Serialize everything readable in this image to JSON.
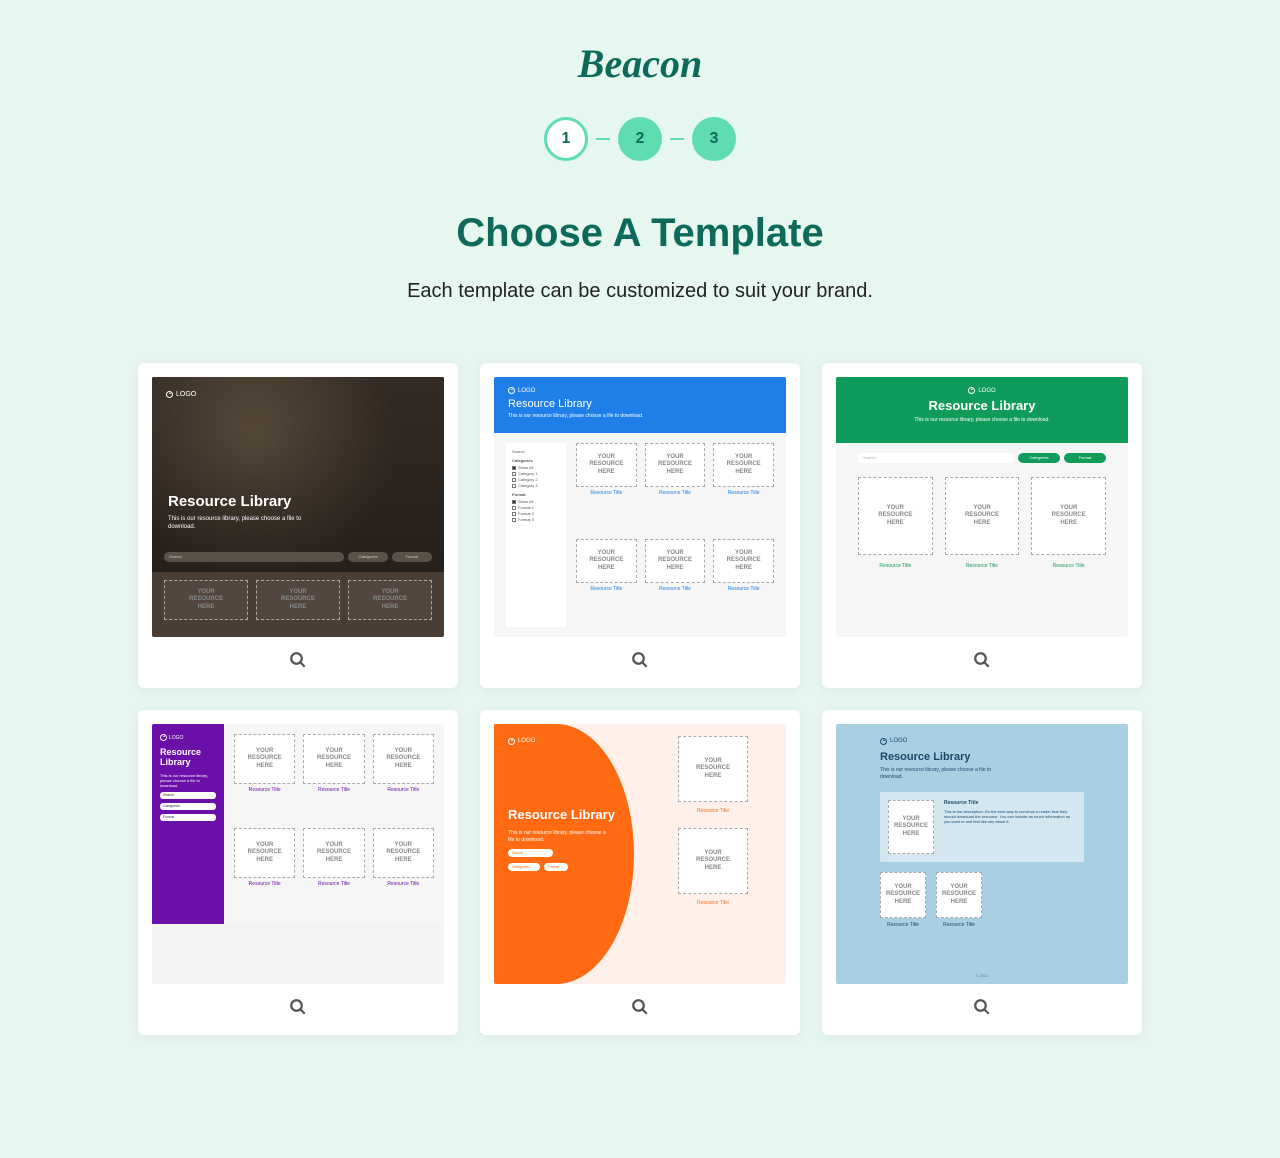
{
  "brand": "Beacon",
  "stepper": {
    "s1": "1",
    "s2": "2",
    "s3": "3"
  },
  "heading": "Choose A Template",
  "subtitle": "Each template can be customized to suit your brand.",
  "common": {
    "logo": "LOGO",
    "title": "Resource Library",
    "desc": "This is our resource library, please choose a file to download.",
    "search": "Search",
    "categories": "Categories",
    "format": "Format",
    "placeholder": "YOUR\nRESOURCE\nHERE",
    "res_title": "Resource Title"
  },
  "t2side": {
    "h_cat": "Categories",
    "show_all": "Show All",
    "cat1": "Category 1",
    "cat2": "Category 2",
    "cat3": "Category 3",
    "h_fmt": "Format",
    "fmt1": "Format 1",
    "fmt2": "Format 2",
    "fmt3": "Format 3"
  },
  "t4desc": "This is our resource library, please choose a file to download.",
  "t6": {
    "desc_short": "This is our resource library, please choose a file to download.",
    "feat_desc": "This is the description. It's the best way to convince a reader that they should download the resource. You can include as much information as you want to and feel like shy about it.",
    "foot": "© 2021"
  }
}
